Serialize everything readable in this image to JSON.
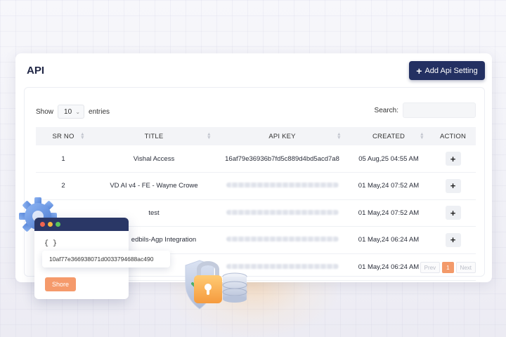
{
  "page": {
    "title": "API",
    "add_button_label": "Add Api Setting"
  },
  "controls": {
    "show_label": "Show",
    "entries_value": "10",
    "entries_label": "entries",
    "search_label": "Search:"
  },
  "table": {
    "columns": [
      "SR NO",
      "TITLE",
      "API KEY",
      "CREATED",
      "ACTION"
    ],
    "rows": [
      {
        "sr": "1",
        "title": "Vishal Access",
        "api_key": "16af79e36936b7fd5c889d4bd5acd7a8",
        "created": "05 Aug,25 04:55 AM"
      },
      {
        "sr": "2",
        "title": "VD AI v4 - FE - Wayne Crowe",
        "api_key": "",
        "created": "01 May,24 07:52 AM"
      },
      {
        "sr": "",
        "title": "test",
        "api_key": "",
        "created": "01 May,24 07:52 AM"
      },
      {
        "sr": "",
        "title": "edbils-Agp Integration",
        "api_key": "",
        "created": "01 May,24 06:24 AM"
      },
      {
        "sr": "",
        "title": "",
        "api_key": "",
        "created": "01 May,24 06:24 AM"
      }
    ],
    "action_glyph": "+"
  },
  "pagination": {
    "prev": "Prev",
    "current": "1",
    "next": "Next"
  },
  "illustration": {
    "braces": "{  }",
    "key_text": "10af77e366938071d0033794688ac490",
    "show_button": "Shore"
  },
  "colors": {
    "primary": "#233062",
    "accent": "#f39a6a"
  }
}
